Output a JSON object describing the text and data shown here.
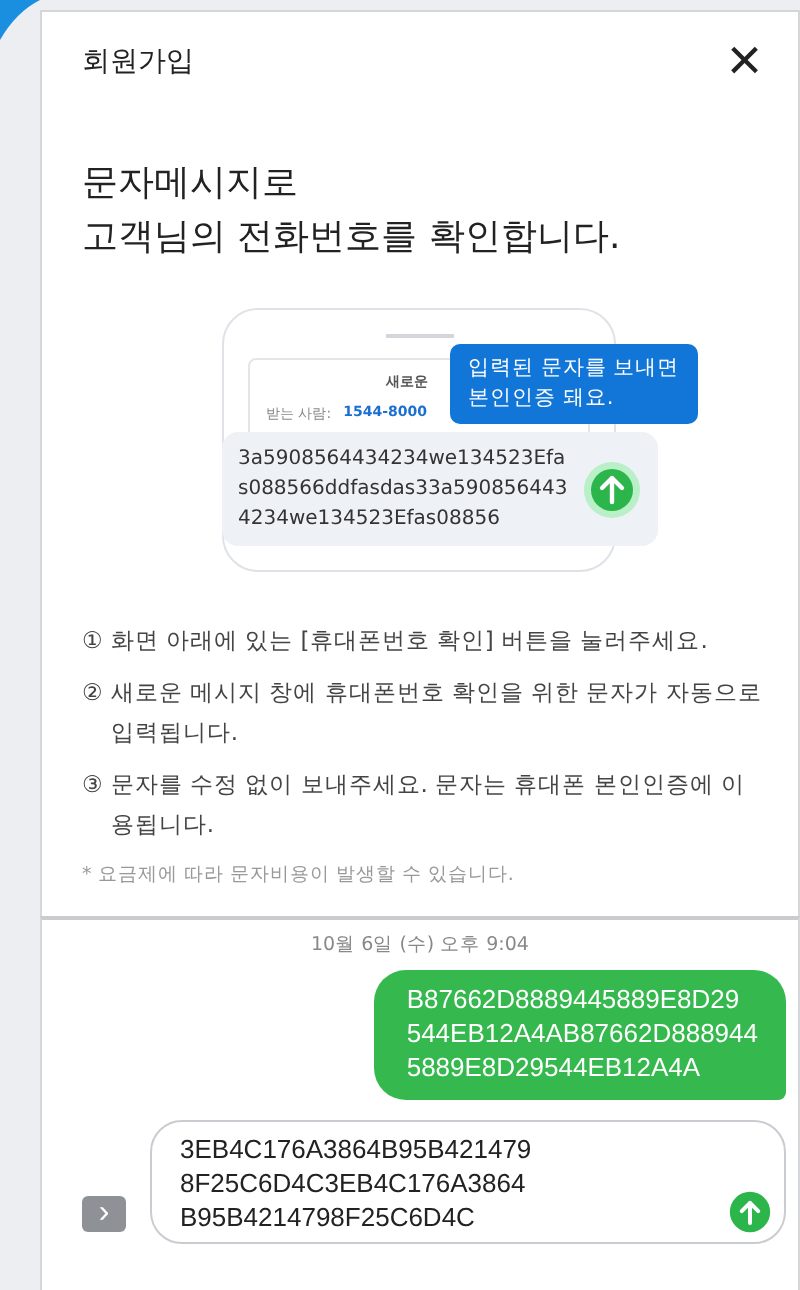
{
  "header": {
    "title": "회원가입",
    "close": "×"
  },
  "heading": [
    "문자메시지로",
    "고객님의 전화번호를 확인합니다."
  ],
  "illustration": {
    "phone_title": "새로운",
    "recipient_label": "받는 사람:",
    "recipient_number": "1544-8000",
    "tooltip": [
      "입력된 문자를 보내면",
      "본인인증 돼요."
    ],
    "code_lines": [
      "3a5908564434234we134523Efa",
      "s088566ddfasdas33a590856443",
      "4234we134523Efas08856"
    ]
  },
  "steps": [
    {
      "mark": "①",
      "text": "화면 아래에 있는 [휴대폰번호 확인] 버튼을 눌러주세요."
    },
    {
      "mark": "②",
      "text": "새로운 메시지 창에 휴대폰번호 확인을 위한 문자가 자동으로 입력됩니다."
    },
    {
      "mark": "③",
      "text": "문자를 수정 없이 보내주세요. 문자는 휴대폰 본인인증에 이용됩니다."
    }
  ],
  "note": "* 요금제에 따라 문자비용이 발생할 수 있습니다.",
  "sms": {
    "timestamp": "10월 6일 (수) 오후 9:04",
    "sent_lines": [
      "B87662D8889445889E8D29",
      "544EB12A4AB87662D888944",
      "5889E8D29544EB12A4A"
    ],
    "input_lines": [
      "3EB4C176A3864B95B421479",
      "8F25C6D4C3EB4C176A3864",
      "B95B4214798F25C6D4C"
    ],
    "expand": "›"
  }
}
